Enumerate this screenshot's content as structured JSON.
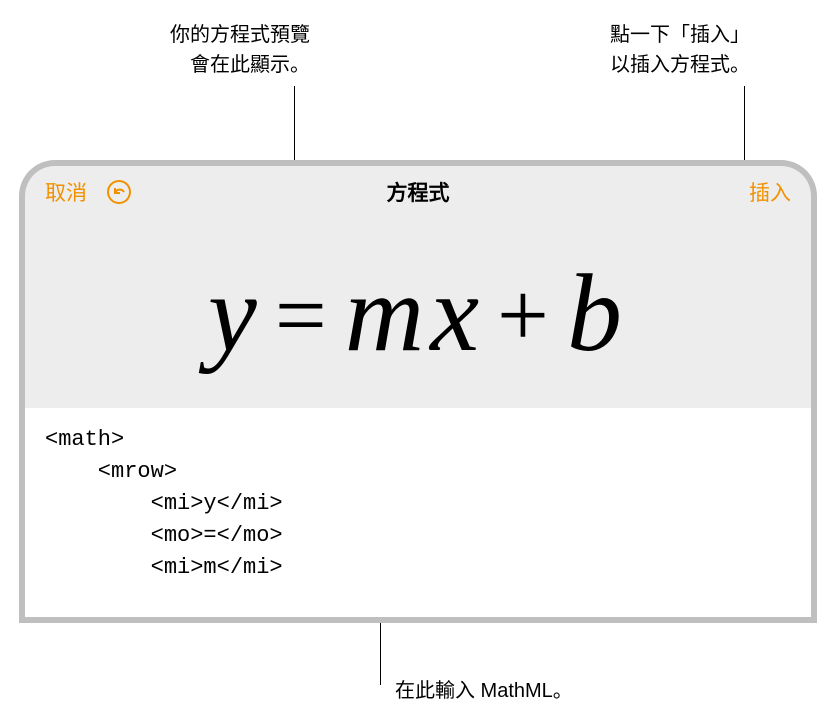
{
  "callouts": {
    "preview_line1": "你的方程式預覽",
    "preview_line2": "會在此顯示。",
    "insert_line1": "點一下「插入」",
    "insert_line2": "以插入方程式。",
    "mathml": "在此輸入 MathML。"
  },
  "toolbar": {
    "cancel": "取消",
    "title": "方程式",
    "insert": "插入"
  },
  "preview": {
    "y": "y",
    "eq": "=",
    "m": "m",
    "x": "x",
    "plus": "+",
    "b": "b"
  },
  "editor": {
    "line1": "<math>",
    "line2": "    <mrow>",
    "line3": "        <mi>y</mi>",
    "line4": "        <mo>=</mo>",
    "line5": "        <mi>m</mi>"
  }
}
